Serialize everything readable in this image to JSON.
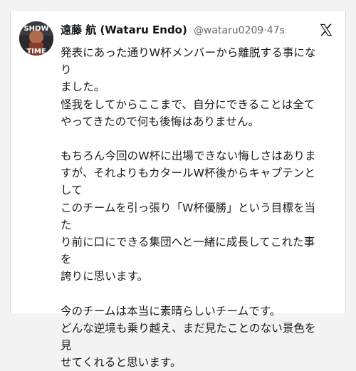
{
  "tweet": {
    "author": {
      "display_name": "遠藤 航 (Wataru Endo)",
      "handle": "@wataru0209",
      "avatar_text_top": "SHOW",
      "avatar_text_bottom": "TIME"
    },
    "time_separator": "·",
    "timestamp": "47s",
    "platform_icon": "x-logo-icon",
    "paragraphs": [
      "発表にあった通りW杯メンバーから離脱する事になり\nました。\n怪我をしてからここまで、自分にできることは全て\nやってきたので何も後悔はありません。",
      "もちろん今回のW杯に出場できない悔しさはありますが、それよりもカタールW杯後からキャプテンとして\nこのチームを引っ張り「W杯優勝」という目標を当た\nり前に口にできる集団へと一緒に成長してこれた事を\n誇りに思います。",
      "今のチームは本当に素晴らしいチームです。\nどんな逆境も乗り越え、まだ見たことのない景色を見\nせてくれると思います。"
    ]
  },
  "colors": {
    "text": "#0f1419",
    "handle": "#606a72",
    "background": "#ffffff"
  }
}
